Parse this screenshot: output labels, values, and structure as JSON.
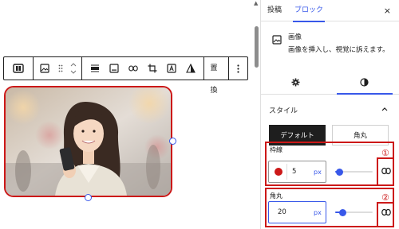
{
  "toolbar": {
    "replace_label": "置換",
    "icons": [
      "align-icon",
      "image-icon",
      "drag-icon",
      "move-up-down-icon",
      "align-full-icon",
      "caption-icon",
      "link-icon",
      "crop-icon",
      "text-overlay-icon",
      "duotone-icon",
      "more-icon"
    ]
  },
  "sidebar": {
    "tabs": [
      {
        "label": "投稿",
        "active": false
      },
      {
        "label": "ブロック",
        "active": true
      }
    ],
    "close_label": "×",
    "block": {
      "title": "画像",
      "description": "画像を挿入し、視覚に訴えます。"
    },
    "subtabs": [
      "settings-icon",
      "styles-icon"
    ],
    "styles_section": {
      "title": "スタイル",
      "options": [
        {
          "label": "デフォルト",
          "selected": true
        },
        {
          "label": "角丸",
          "selected": false
        }
      ]
    },
    "border": {
      "label": "枠線",
      "color": "#cc1818",
      "width_value": "5",
      "unit": "px",
      "slider_fraction": 0.1,
      "annotation": "①"
    },
    "radius": {
      "label": "角丸",
      "value": "20",
      "unit": "px",
      "slider_fraction": 0.2,
      "annotation": "②"
    }
  },
  "colors": {
    "accent": "#3858e9",
    "highlight": "#cc1818",
    "dark": "#1e1e1e"
  }
}
